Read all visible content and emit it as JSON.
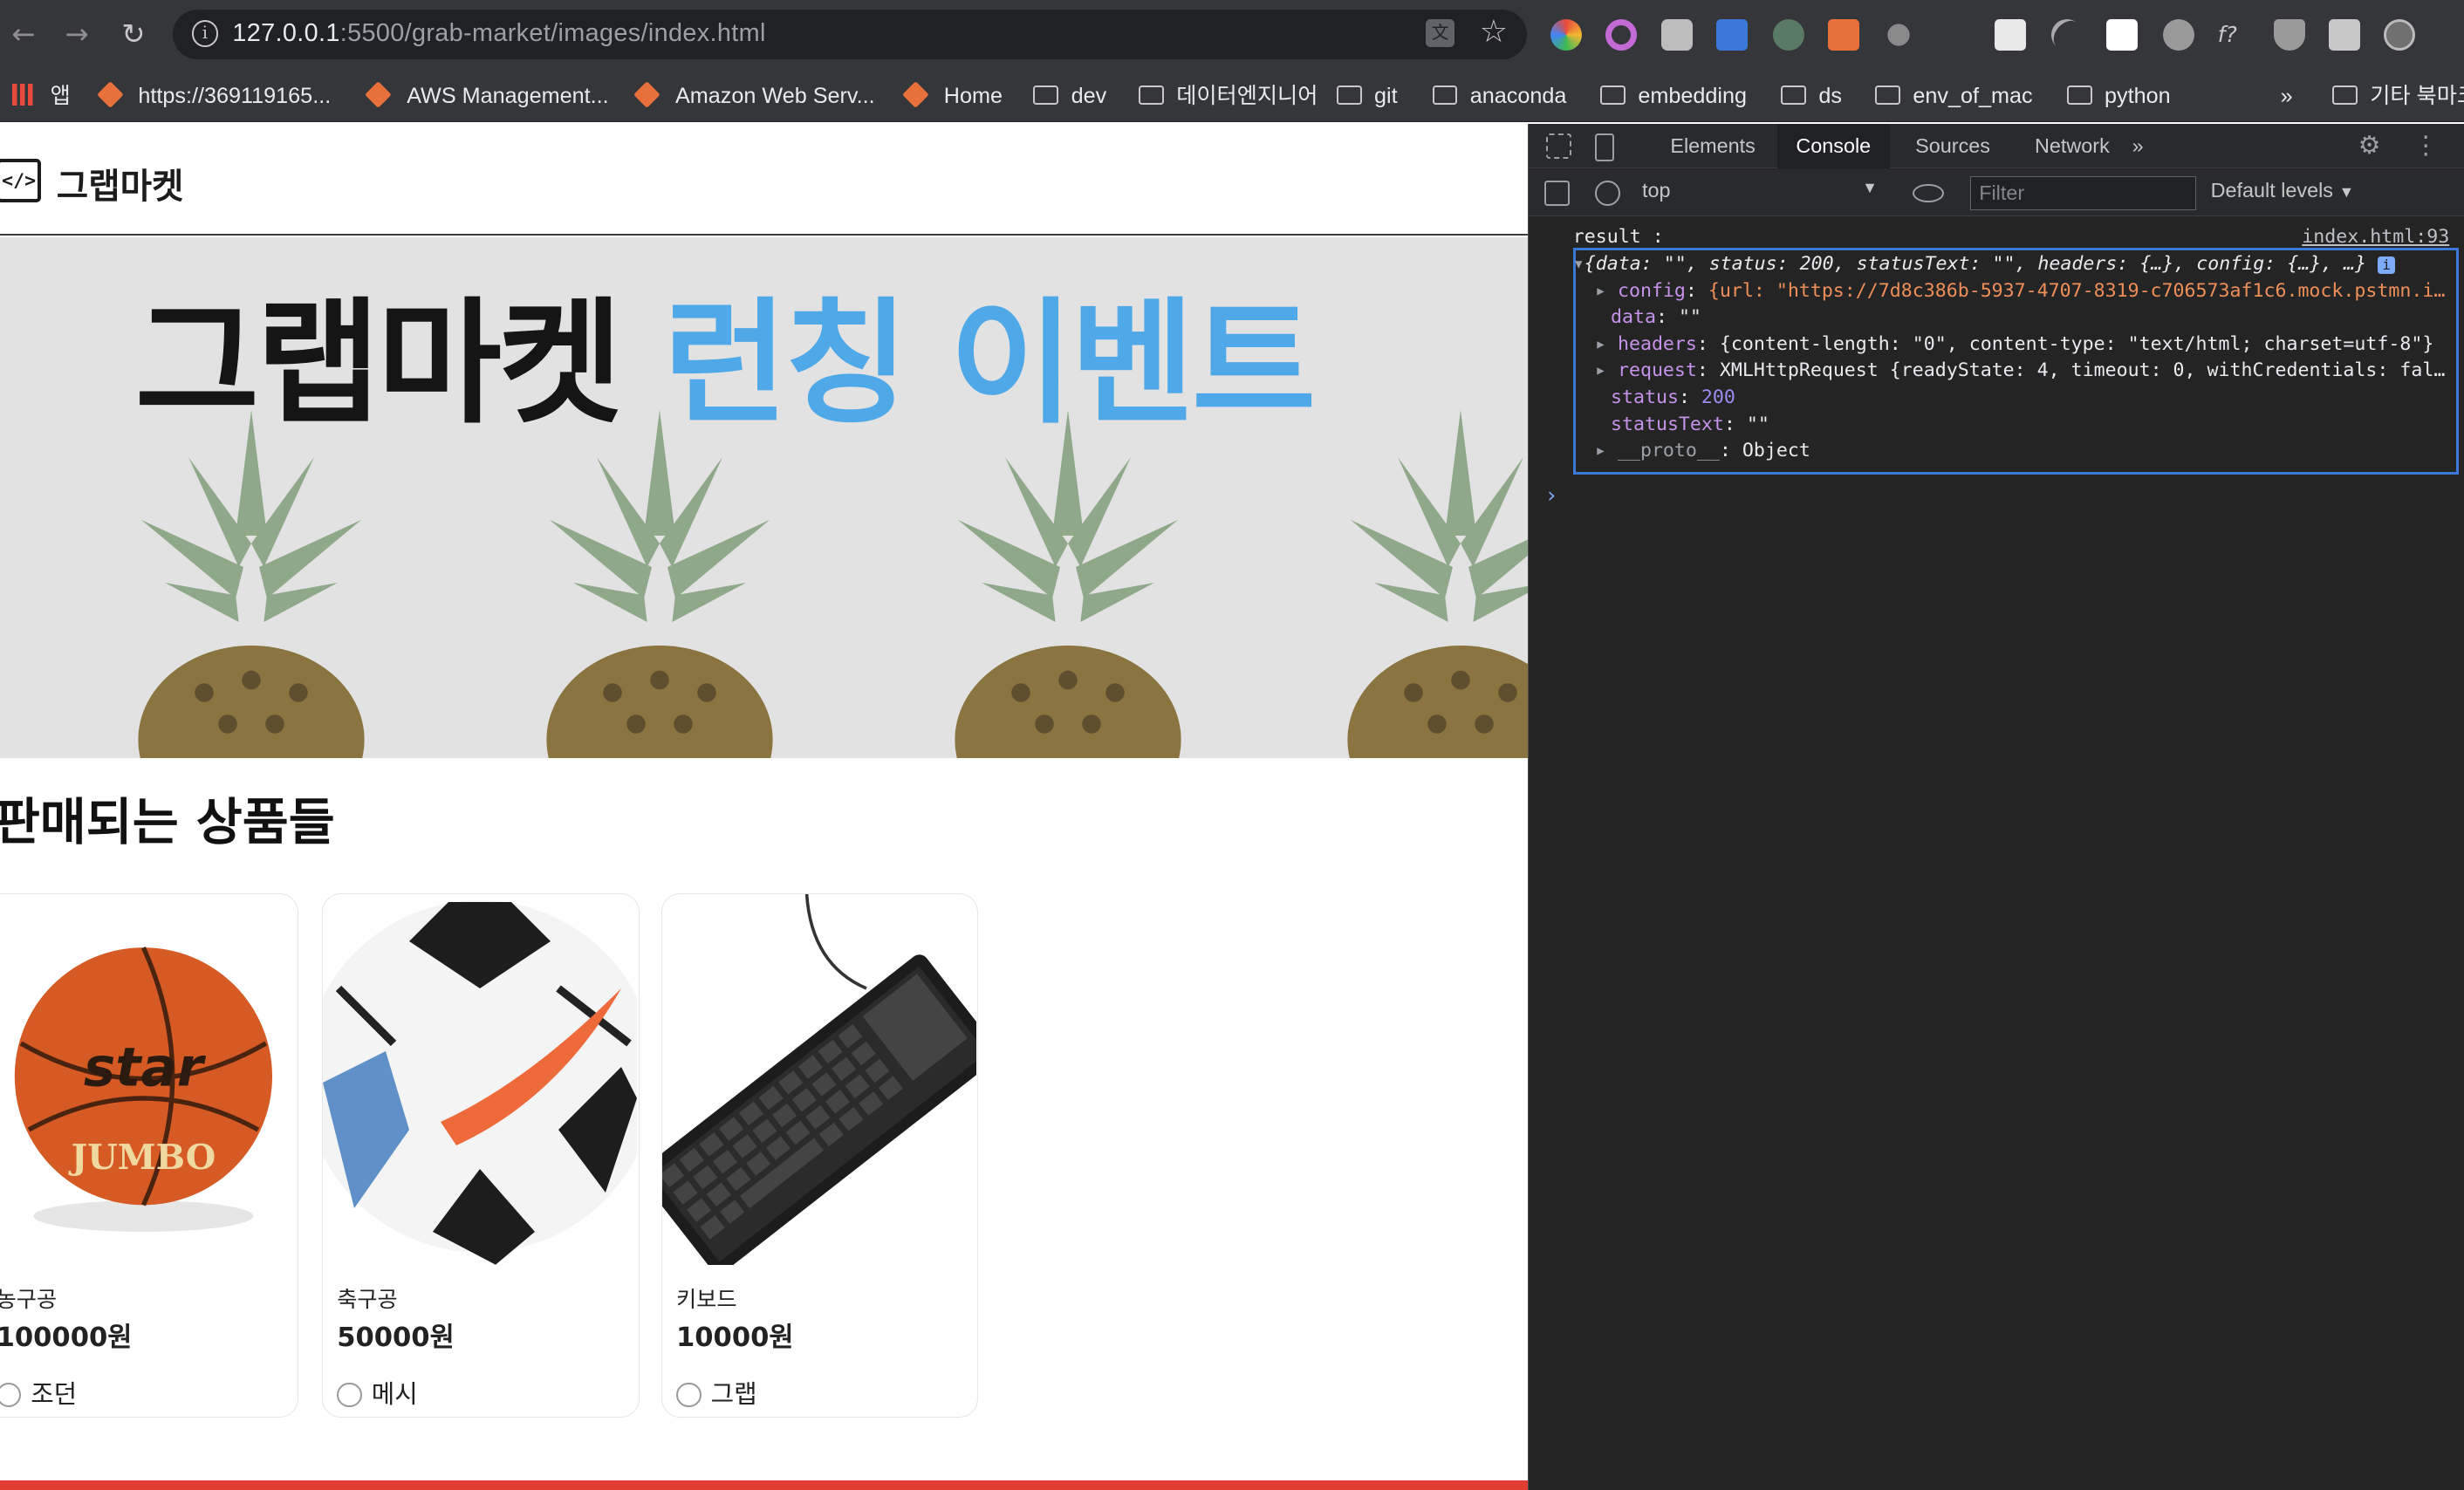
{
  "browser": {
    "url_host": "127.0.0.1",
    "url_rest": ":5500/grab-market/images/index.html",
    "bookmarks": [
      {
        "label": "앱",
        "kind": "apps"
      },
      {
        "label": "https://369119165...",
        "kind": "cube"
      },
      {
        "label": "AWS Management...",
        "kind": "cube"
      },
      {
        "label": "Amazon Web Serv...",
        "kind": "cube"
      },
      {
        "label": "Home",
        "kind": "cube"
      },
      {
        "label": "dev",
        "kind": "folder"
      },
      {
        "label": "데이터엔지니어",
        "kind": "folder"
      },
      {
        "label": "git",
        "kind": "folder"
      },
      {
        "label": "anaconda",
        "kind": "folder"
      },
      {
        "label": "embedding",
        "kind": "folder"
      },
      {
        "label": "ds",
        "kind": "folder"
      },
      {
        "label": "env_of_mac",
        "kind": "folder"
      },
      {
        "label": "python",
        "kind": "folder"
      },
      {
        "label": "기타 북마크",
        "kind": "folder"
      }
    ],
    "overflow": "»"
  },
  "page": {
    "logo_text": "그랩마켓",
    "banner": {
      "title_main": "그랩마켓",
      "title_accent": "런칭 이벤트"
    },
    "section_title": "판매되는 상품들",
    "products": [
      {
        "name": "농구공",
        "price": "100000원",
        "seller": "조던",
        "image": "basketball"
      },
      {
        "name": "축구공",
        "price": "50000원",
        "seller": "메시",
        "image": "soccer-ball"
      },
      {
        "name": "키보드",
        "price": "10000원",
        "seller": "그랩",
        "image": "keyboard"
      }
    ]
  },
  "devtools": {
    "tabs": [
      "Elements",
      "Console",
      "Sources",
      "Network"
    ],
    "active_tab": "Console",
    "more": "»",
    "context": "top",
    "filter_placeholder": "Filter",
    "levels": "Default levels",
    "log_label": "result :",
    "log_source": "index.html:93",
    "object_summary": "{data: \"\", status: 200, statusText: \"\", headers: {…}, config: {…}, …}",
    "props": [
      {
        "key": "config",
        "value": "{url: \"https://7d8c386b-5937-4707-8319-c706573af1c6.mock.pstmn.i…",
        "expandable": true
      },
      {
        "key": "data",
        "value": "\"\"",
        "expandable": false
      },
      {
        "key": "headers",
        "value": "{content-length: \"0\", content-type: \"text/html; charset=utf-8\"}",
        "expandable": true
      },
      {
        "key": "request",
        "value": "XMLHttpRequest {readyState: 4, timeout: 0, withCredentials: fal…",
        "expandable": true
      },
      {
        "key": "status",
        "value": "200",
        "expandable": false
      },
      {
        "key": "statusText",
        "value": "\"\"",
        "expandable": false
      },
      {
        "key": "__proto__",
        "value": "Object",
        "expandable": true
      }
    ]
  },
  "colors": {
    "accent_blue": "#4fa9e8",
    "bottom_bar": "#e03c2f",
    "devtools_bg": "#242424"
  }
}
